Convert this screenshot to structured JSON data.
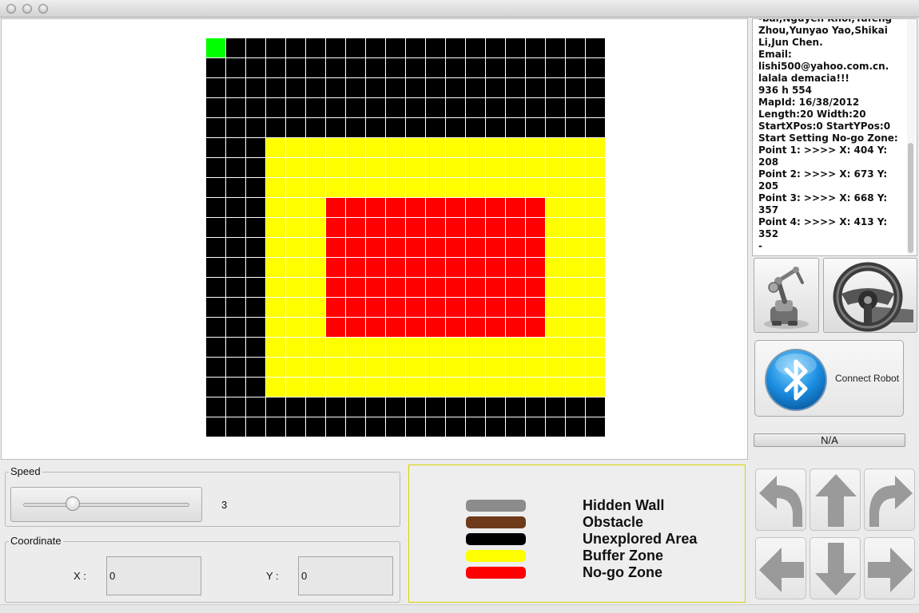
{
  "window": {
    "title": ""
  },
  "map": {
    "rows": 20,
    "cols": 20,
    "colors": {
      "unexplored": "#000000",
      "buffer": "#ffff00",
      "nogo": "#ff0000",
      "robot": "#00ff00"
    },
    "robot": {
      "row": 0,
      "col": 0
    },
    "buffer_zone": {
      "row_start": 5,
      "row_end": 17,
      "col_start": 3,
      "col_end": 19
    },
    "nogo_zone": {
      "row_start": 8,
      "row_end": 14,
      "col_start": 6,
      "col_end": 16
    }
  },
  "log": {
    "lines": [
      "-bai,Nguyen Khoi,Yafeng",
      "Zhou,Yunyao Yao,Shikai",
      "Li,Jun Chen.",
      "Email:",
      "lishi500@yahoo.com.cn.",
      "lalala demacia!!!",
      "936 h 554",
      "MapId: 16/38/2012",
      "Length:20 Width:20",
      "StartXPos:0 StartYPos:0",
      "Start Setting No-go Zone:",
      "Point 1: >>>>  X: 404 Y:",
      "208",
      "Point 2: >>>>  X: 673 Y:",
      "205",
      "Point 3: >>>>  X: 668 Y:",
      "357",
      "Point 4: >>>>  X: 413 Y:",
      "352",
      "-"
    ]
  },
  "controls": {
    "robot_arm_icon": "robot-arm-icon",
    "steering_wheel_icon": "steering-wheel-icon",
    "connect_label": "Connect Robot",
    "status": "N/A"
  },
  "speed": {
    "title": "Speed",
    "value": "3",
    "level": 0.3
  },
  "coordinate": {
    "title": "Coordinate",
    "x_label": "X :",
    "y_label": "Y :",
    "x_value": "0",
    "y_value": "0"
  },
  "legend": [
    {
      "label": "Hidden Wall",
      "color": "#8c8c8c"
    },
    {
      "label": "Obstacle",
      "color": "#6e3a1a"
    },
    {
      "label": "Unexplored Area",
      "color": "#000000"
    },
    {
      "label": "Buffer Zone",
      "color": "#ffff00"
    },
    {
      "label": "No-go Zone",
      "color": "#ff0000"
    }
  ],
  "nav_buttons": [
    "turn-left",
    "forward",
    "turn-right",
    "left",
    "backward",
    "right"
  ]
}
